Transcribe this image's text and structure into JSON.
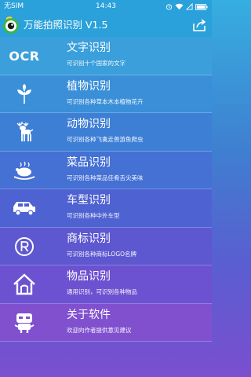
{
  "statusbar": {
    "carrier": "无SIM",
    "time": "14:43"
  },
  "appbar": {
    "title": "万能拍照识别 V1.5"
  },
  "items": [
    {
      "name": "文字识别",
      "desc": "可识别十个国家的文字",
      "icon": "ocr-icon",
      "icon_text": "OCR",
      "bg": "#3a9fdb"
    },
    {
      "name": "植物识别",
      "desc": "可识别各种草本木本植物花卉",
      "icon": "plant-icon",
      "bg": "#3a8fd8"
    },
    {
      "name": "动物识别",
      "desc": "可识别各种飞禽走兽游鱼爬虫",
      "icon": "deer-icon",
      "bg": "#3e7fd6"
    },
    {
      "name": "菜品识别",
      "desc": "可识别各种菜品佳肴舌尖美味",
      "icon": "roast-chicken-icon",
      "bg": "#4570d4"
    },
    {
      "name": "车型识别",
      "desc": "可识别各种中外车型",
      "icon": "car-icon",
      "bg": "#4f62d2"
    },
    {
      "name": "商标识别",
      "desc": "可识别各种商标LOGO名牌",
      "icon": "registered-trademark-icon",
      "bg": "#5d58d0"
    },
    {
      "name": "物品识别",
      "desc": "通用识别，可识别各种物品",
      "icon": "house-icon",
      "bg": "#6c52d0"
    },
    {
      "name": "关于软件",
      "desc": "欢迎向作者提供意见建议",
      "icon": "robot-icon",
      "bg": "#8050cf"
    }
  ]
}
